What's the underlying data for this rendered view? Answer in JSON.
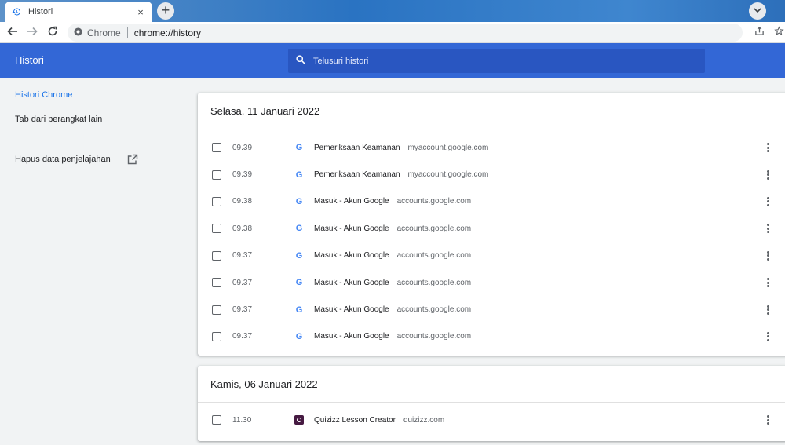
{
  "tab": {
    "title": "Histori",
    "close": "×",
    "new_tab": "+"
  },
  "omnibox": {
    "site_chip": "Chrome",
    "url": "chrome://history"
  },
  "header": {
    "title": "Histori",
    "search_placeholder": "Telusuri histori"
  },
  "sidebar": {
    "items": [
      {
        "label": "Histori Chrome",
        "active": true
      },
      {
        "label": "Tab dari perangkat lain",
        "active": false
      },
      {
        "label": "Hapus data penjelajahan",
        "active": false
      }
    ]
  },
  "groups": [
    {
      "date": "Selasa, 11 Januari 2022",
      "entries": [
        {
          "time": "09.39",
          "title": "Pemeriksaan Keamanan",
          "domain": "myaccount.google.com",
          "favicon": "google-icon"
        },
        {
          "time": "09.39",
          "title": "Pemeriksaan Keamanan",
          "domain": "myaccount.google.com",
          "favicon": "google-icon"
        },
        {
          "time": "09.38",
          "title": "Masuk - Akun Google",
          "domain": "accounts.google.com",
          "favicon": "google-icon"
        },
        {
          "time": "09.38",
          "title": "Masuk - Akun Google",
          "domain": "accounts.google.com",
          "favicon": "google-icon"
        },
        {
          "time": "09.37",
          "title": "Masuk - Akun Google",
          "domain": "accounts.google.com",
          "favicon": "google-icon"
        },
        {
          "time": "09.37",
          "title": "Masuk - Akun Google",
          "domain": "accounts.google.com",
          "favicon": "google-icon"
        },
        {
          "time": "09.37",
          "title": "Masuk - Akun Google",
          "domain": "accounts.google.com",
          "favicon": "google-icon"
        },
        {
          "time": "09.37",
          "title": "Masuk - Akun Google",
          "domain": "accounts.google.com",
          "favicon": "google-icon"
        }
      ]
    },
    {
      "date": "Kamis, 06 Januari 2022",
      "entries": [
        {
          "time": "11.30",
          "title": "Quizizz Lesson Creator",
          "domain": "quizizz.com",
          "favicon": "quizizz-icon"
        }
      ]
    }
  ],
  "colors": {
    "header": "#3367d6",
    "search_bg": "#2956c1",
    "accent": "#1a73e8"
  }
}
